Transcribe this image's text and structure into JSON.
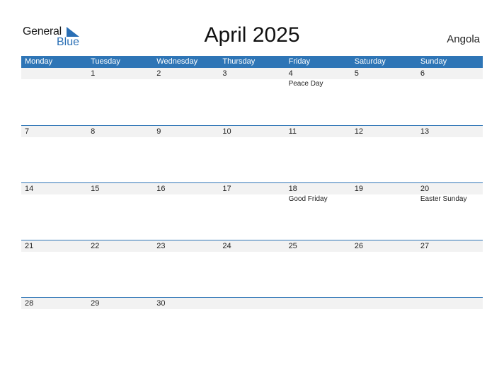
{
  "logo": {
    "general": "General",
    "blue": "Blue"
  },
  "title": "April 2025",
  "country": "Angola",
  "colors": {
    "accent": "#2e75b6",
    "row_bg": "#f2f2f2"
  },
  "weekdays": [
    "Monday",
    "Tuesday",
    "Wednesday",
    "Thursday",
    "Friday",
    "Saturday",
    "Sunday"
  ],
  "weeks": [
    {
      "days": [
        "",
        "1",
        "2",
        "3",
        "4",
        "5",
        "6"
      ],
      "holidays": [
        "",
        "",
        "",
        "",
        "Peace Day",
        "",
        ""
      ]
    },
    {
      "days": [
        "7",
        "8",
        "9",
        "10",
        "11",
        "12",
        "13"
      ],
      "holidays": [
        "",
        "",
        "",
        "",
        "",
        "",
        ""
      ]
    },
    {
      "days": [
        "14",
        "15",
        "16",
        "17",
        "18",
        "19",
        "20"
      ],
      "holidays": [
        "",
        "",
        "",
        "",
        "Good Friday",
        "",
        "Easter Sunday"
      ]
    },
    {
      "days": [
        "21",
        "22",
        "23",
        "24",
        "25",
        "26",
        "27"
      ],
      "holidays": [
        "",
        "",
        "",
        "",
        "",
        "",
        ""
      ]
    },
    {
      "days": [
        "28",
        "29",
        "30",
        "",
        "",
        "",
        ""
      ],
      "holidays": [
        "",
        "",
        "",
        "",
        "",
        "",
        ""
      ]
    }
  ]
}
